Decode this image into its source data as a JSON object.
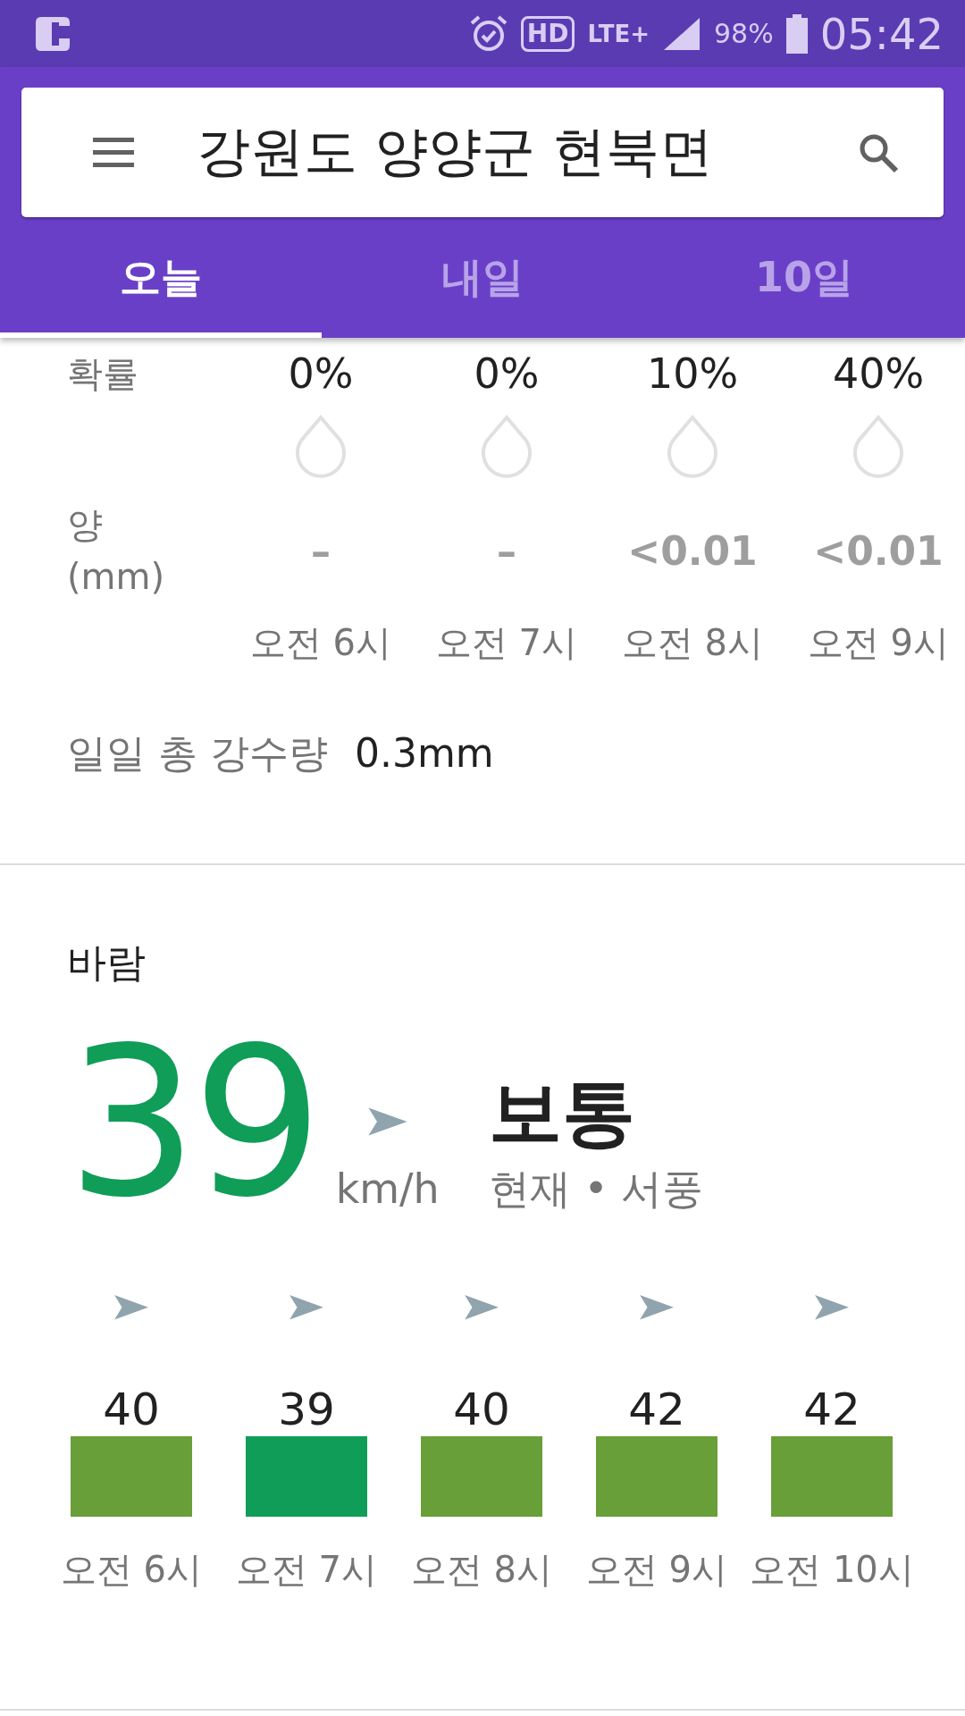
{
  "status_bar": {
    "network": "HD",
    "lte": "LTE+",
    "battery": "98%",
    "time": "05:42"
  },
  "search": {
    "value": "강원도 양양군 현북면"
  },
  "tabs": [
    {
      "label": "오늘",
      "selected": true
    },
    {
      "label": "내일",
      "selected": false
    },
    {
      "label": "10일",
      "selected": false
    }
  ],
  "precipitation": {
    "probability_label": "확률",
    "amount_label": "양",
    "amount_unit": "(mm)",
    "hours": [
      {
        "probability": "0%",
        "amount": "–",
        "time": "오전 6시"
      },
      {
        "probability": "0%",
        "amount": "–",
        "time": "오전 7시"
      },
      {
        "probability": "10%",
        "amount": "<0.01",
        "time": "오전 8시"
      },
      {
        "probability": "40%",
        "amount": "<0.01",
        "time": "오전 9시"
      }
    ],
    "daily_total_label": "일일 총 강수량",
    "daily_total": "0.3mm"
  },
  "wind": {
    "title": "바람",
    "speed": "39",
    "unit": "km/h",
    "condition": "보통",
    "description": "현재 • 서풍",
    "hours": [
      {
        "speed": "40",
        "time": "오전 6시",
        "color": "#689f38"
      },
      {
        "speed": "39",
        "time": "오전 7시",
        "color": "#0f9d58"
      },
      {
        "speed": "40",
        "time": "오전 8시",
        "color": "#689f38"
      },
      {
        "speed": "42",
        "time": "오전 9시",
        "color": "#689f38"
      },
      {
        "speed": "42",
        "time": "오전 10시",
        "color": "#689f38"
      }
    ]
  }
}
